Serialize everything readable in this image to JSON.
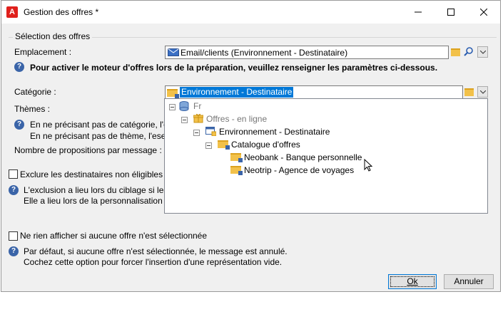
{
  "window": {
    "title": "Gestion des offres *",
    "app_icon_letter": "A"
  },
  "section": {
    "title": "Sélection des offres"
  },
  "emplacement": {
    "label": "Emplacement :",
    "value": "Email/clients (Environnement - Destinataire)"
  },
  "info_emplacement": "Pour activer le moteur d'offres lors de la préparation, veuillez renseigner les paramètres ci-dessous.",
  "categorie": {
    "label": "Catégorie :",
    "value": "Environnement - Destinataire"
  },
  "themes": {
    "label": "Thèmes :"
  },
  "info_categorie": {
    "line1": "En ne précisant pas de catégorie, l'e",
    "line2": "En ne précisant pas de thème, l'ese"
  },
  "propositions": {
    "label": "Nombre de propositions par message :"
  },
  "exclude": {
    "label": "Exclure les destinataires non éligibles",
    "checked": false
  },
  "info_exclude": {
    "line1": "L'exclusion a lieu lors du ciblage si les",
    "line2": "Elle a lieu lors de la personnalisation d"
  },
  "nothing": {
    "label": "Ne rien afficher si aucune offre n'est sélectionnée",
    "checked": false
  },
  "info_nothing": {
    "line1": "Par défaut, si aucune offre n'est sélectionnée, le message est annulé.",
    "line2": "Cochez cette option pour forcer l'insertion d'une représentation vide."
  },
  "tree": {
    "root": "Fr",
    "offres": "Offres - en ligne",
    "env": "Environnement - Destinataire",
    "catalogue": "Catalogue d'offres",
    "neobank": "Neobank - Banque personnelle",
    "neotrip": "Neotrip - Agence de voyages"
  },
  "buttons": {
    "ok": "Ok",
    "cancel": "Annuler"
  },
  "colors": {
    "accent": "#0078d7",
    "folder": "#f2c14a",
    "info": "#3a64a8"
  }
}
